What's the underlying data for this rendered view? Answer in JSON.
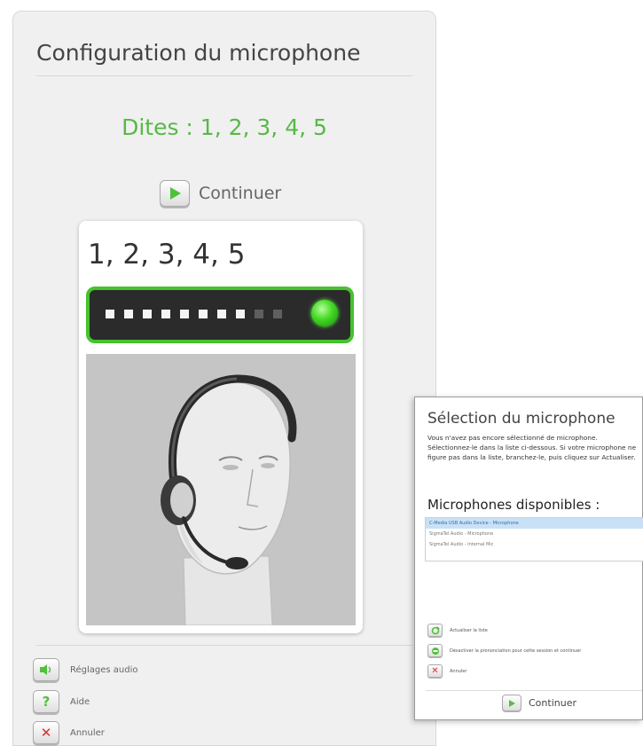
{
  "main_dialog": {
    "title": "Configuration du microphone",
    "instruction": "Dites : 1, 2, 3, 4, 5",
    "continue_label": "Continuer",
    "card_text": "1, 2, 3, 4, 5",
    "meter_level": 0.8,
    "bottom_actions": [
      {
        "label": "Réglages audio",
        "icon": "speaker-icon"
      },
      {
        "label": "Aide",
        "icon": "help-icon"
      },
      {
        "label": "Annuler",
        "icon": "close-icon"
      }
    ]
  },
  "selection_dialog": {
    "title": "Sélection du microphone",
    "description": "Vous n'avez pas encore sélectionné de microphone. Sélectionnez-le dans la liste ci-dessous. Si votre microphone ne figure pas dans la liste, branchez-le, puis cliquez sur Actualiser.",
    "subtitle": "Microphones disponibles :",
    "microphones": [
      "C-Media USB Audio Device  -  Microphone",
      "SigmaTel Audio - Microphone",
      "SigmaTel Audio - Internal Mic"
    ],
    "actions": [
      {
        "label": "Actualiser la liste",
        "icon": "refresh-icon"
      },
      {
        "label": "Désactiver la prononciation pour cette session et continuer",
        "icon": "skip-icon"
      },
      {
        "label": "Annuler",
        "icon": "close-icon"
      }
    ],
    "continue_label": "Continuer"
  },
  "colors": {
    "accent_green": "#57b947",
    "meter_border": "#46c22d",
    "cancel_red": "#d9302a",
    "selection_blue": "#c9e1f7"
  }
}
